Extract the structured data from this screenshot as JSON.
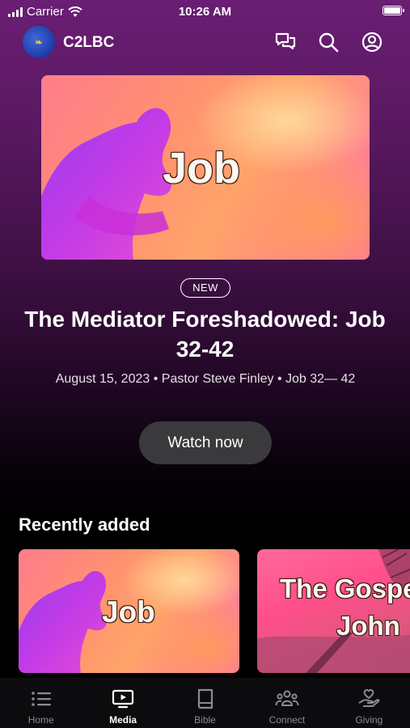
{
  "status": {
    "carrier": "Carrier",
    "time": "10:26 AM"
  },
  "header": {
    "brand": "C2LBC",
    "logo_text": "❧"
  },
  "hero": {
    "art_title": "Job",
    "badge": "NEW",
    "title": "The Mediator Foreshadowed: Job 32-42",
    "meta": "August 15, 2023 • Pastor Steve Finley • Job 32— 42",
    "cta": "Watch now"
  },
  "recent": {
    "heading": "Recently added",
    "items": [
      {
        "art_title": "Job"
      },
      {
        "art_title_line1": "The Gospe",
        "art_title_line2": "John"
      }
    ]
  },
  "tabs": [
    {
      "label": "Home",
      "icon": "list-icon"
    },
    {
      "label": "Media",
      "icon": "play-tv-icon",
      "active": true
    },
    {
      "label": "Bible",
      "icon": "book-icon"
    },
    {
      "label": "Connect",
      "icon": "people-icon"
    },
    {
      "label": "Giving",
      "icon": "heart-hand-icon"
    }
  ],
  "colors": {
    "accent_bg": "#6a1e74",
    "button_bg": "#3a3a3d",
    "tab_inactive": "#8b8b90"
  }
}
